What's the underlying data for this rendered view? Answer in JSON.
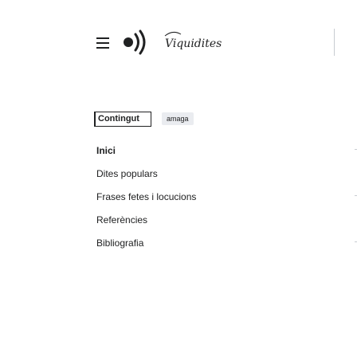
{
  "header": {
    "menu_icon": "hamburger-menu-icon",
    "logo_icon": "waves-logo-icon",
    "wordmark": "Viquidites"
  },
  "tabs": {
    "contents_label": "Contingut",
    "hide_label": "amaga"
  },
  "toc": {
    "items": [
      "Inici",
      "Dites populars",
      "Frases fetes i locucions",
      "Referències",
      "Bibliografia"
    ]
  },
  "colors": {
    "text": "#202122",
    "button_bg": "#eaecf0",
    "divider": "#c8ccd1"
  }
}
